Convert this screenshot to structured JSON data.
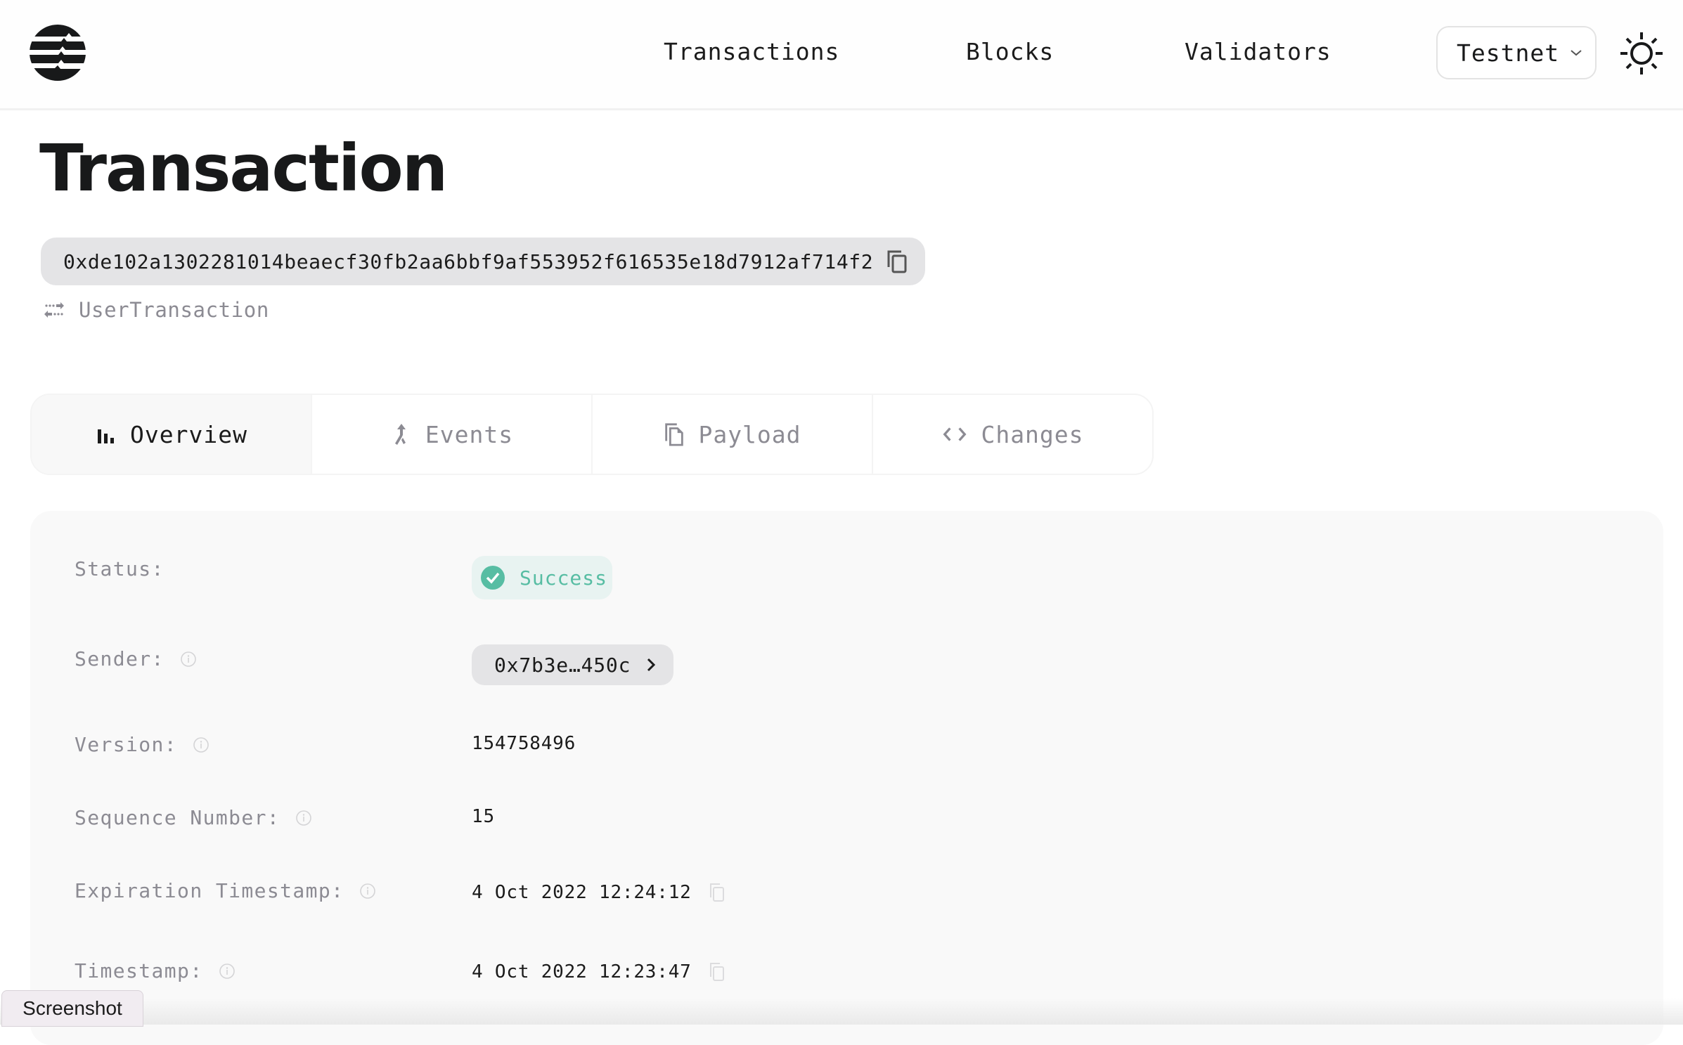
{
  "header": {
    "logo": "aptos-logo-icon",
    "nav": [
      {
        "label": "Transactions"
      },
      {
        "label": "Blocks"
      },
      {
        "label": "Validators"
      }
    ],
    "network_selector": {
      "selected": "Testnet",
      "icon": "chevron-down-icon"
    },
    "theme_toggle": {
      "icon": "sun-icon"
    }
  },
  "page": {
    "title": "Transaction",
    "hash": "0xde102a1302281014beaecf30fb2aa6bbf9af553952f616535e18d7912af714f2",
    "type": "UserTransaction"
  },
  "tabs": [
    {
      "label": "Overview",
      "icon": "bar-chart-icon",
      "active": true
    },
    {
      "label": "Events",
      "icon": "merge-arrow-icon",
      "active": false
    },
    {
      "label": "Payload",
      "icon": "file-copy-icon",
      "active": false
    },
    {
      "label": "Changes",
      "icon": "code-icon",
      "active": false
    }
  ],
  "overview": {
    "status": {
      "label": "Status:",
      "value": "Success"
    },
    "sender": {
      "label": "Sender:",
      "value": "0x7b3e…450c"
    },
    "version": {
      "label": "Version:",
      "value": "154758496"
    },
    "sequence_number": {
      "label": "Sequence Number:",
      "value": "15"
    },
    "expiration_timestamp": {
      "label": "Expiration Timestamp:",
      "value": "4 Oct 2022 12:24:12"
    },
    "timestamp": {
      "label": "Timestamp:",
      "value": "4 Oct 2022 12:23:47"
    }
  },
  "colors": {
    "success": "#57bda3",
    "success_bg": "#e8f3f1",
    "muted_text": "#8c8b93",
    "pill_bg": "#e4e4e6"
  },
  "overlay": {
    "screenshot_label": "Screenshot"
  }
}
